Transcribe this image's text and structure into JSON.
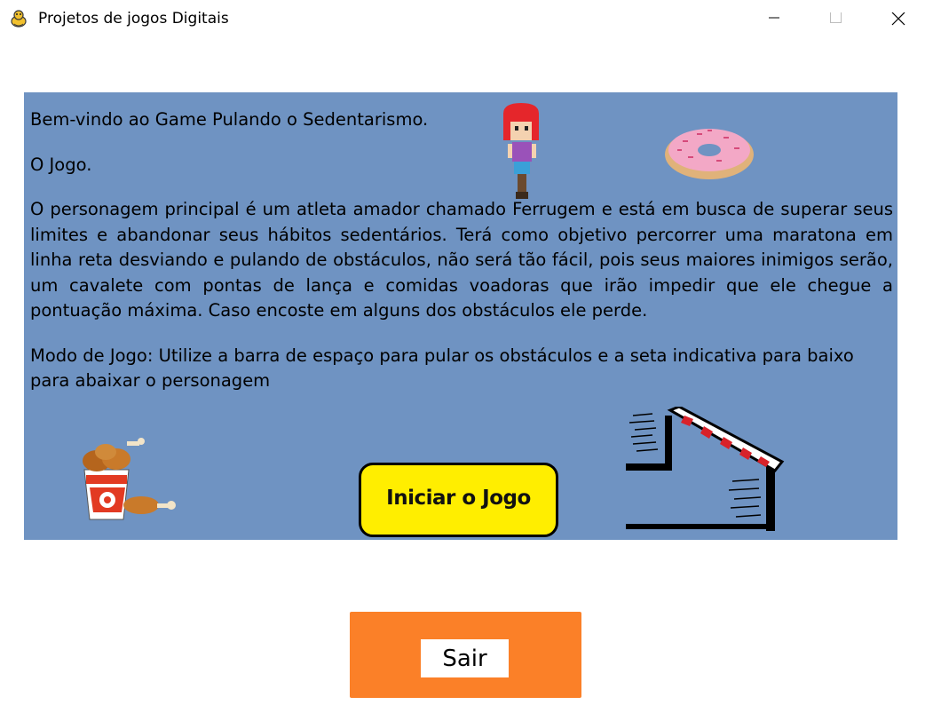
{
  "window": {
    "title": "Projetos de jogos Digitais",
    "icon": "pygame-snake-icon",
    "controls": [
      "minimize-icon",
      "maximize-icon",
      "close-icon"
    ]
  },
  "panel": {
    "background_color": "#6f93c2",
    "welcome": "Bem-vindo ao Game Pulando o Sedentarismo.",
    "game_heading": "O Jogo.",
    "description": "O personagem principal é um atleta amador chamado Ferrugem e está em busca de superar seus limites e abandonar seus hábitos sedentários. Terá como objetivo percorrer uma maratona em linha reta desviando e pulando de obstáculos, não será tão fácil, pois seus maiores inimigos serão, um cavalete com pontas de lança e comidas voadoras que irão impedir que ele chegue a pontuação máxima. Caso encoste em alguns dos obstáculos ele perde.",
    "game_mode": "Modo de Jogo:  Utilize a barra de espaço para pular os obstáculos e a seta indicativa para baixo para abaixar o personagem",
    "images": [
      "character-sprite",
      "donut-sprite",
      "fried-chicken-bucket-sprite",
      "hurdle-sprite"
    ],
    "start_button": {
      "label": "Iniciar o Jogo",
      "color": "#ffee00"
    }
  },
  "exit_button": {
    "label": "Sair",
    "color": "#fb8028"
  }
}
